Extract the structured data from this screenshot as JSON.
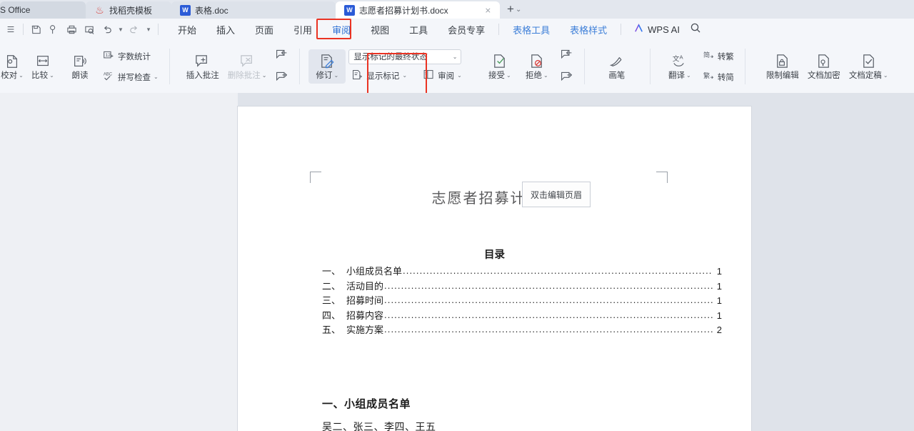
{
  "window": {
    "tabs": [
      {
        "label": "S Office",
        "icon": "wps-home-icon",
        "type": "home"
      },
      {
        "label": "找稻壳模板",
        "icon": "docer-icon",
        "type": "inactive"
      },
      {
        "label": "表格.doc",
        "icon": "word-icon",
        "type": "inactive"
      },
      {
        "label": "志愿者招募计划书.docx",
        "icon": "word-icon",
        "type": "active"
      }
    ],
    "new_tab_label": "+",
    "new_tab_caret": "⌄",
    "close_glyph": "⨯"
  },
  "quick_access": [
    {
      "name": "save-icon"
    },
    {
      "name": "cloud-sync-icon"
    },
    {
      "name": "print-icon"
    },
    {
      "name": "print-preview-icon"
    },
    {
      "name": "undo-icon"
    },
    {
      "name": "undo-caret"
    },
    {
      "name": "redo-icon"
    },
    {
      "name": "more-caret"
    }
  ],
  "ribbon_tabs": [
    {
      "label": "开始",
      "state": "normal"
    },
    {
      "label": "插入",
      "state": "normal"
    },
    {
      "label": "页面",
      "state": "normal"
    },
    {
      "label": "引用",
      "state": "normal"
    },
    {
      "label": "审阅",
      "state": "active"
    },
    {
      "label": "视图",
      "state": "normal"
    },
    {
      "label": "工具",
      "state": "normal"
    },
    {
      "label": "会员专享",
      "state": "normal"
    },
    {
      "label": "表格工具",
      "state": "contextual"
    },
    {
      "label": "表格样式",
      "state": "contextual"
    }
  ],
  "wps_ai": {
    "label": "WPS AI",
    "icon": "wps-ai-icon"
  },
  "search": {
    "icon": "search-icon"
  },
  "ribbon": {
    "group_proof": [
      {
        "label": "校对",
        "icon": "proofread-icon",
        "caret": "⌄",
        "disabled": false
      },
      {
        "label": "比较",
        "icon": "compare-icon",
        "caret": "⌄",
        "disabled": false
      },
      {
        "label": "朗读",
        "icon": "read-aloud-icon",
        "caret": "",
        "disabled": false
      }
    ],
    "group_proof_stack": [
      {
        "label": "字数统计",
        "icon": "word-count-icon",
        "caret": ""
      },
      {
        "label": "拼写检查",
        "icon": "spell-check-icon",
        "caret": "⌄"
      }
    ],
    "group_comment": [
      {
        "label": "插入批注",
        "icon": "insert-comment-icon",
        "caret": "",
        "disabled": false
      },
      {
        "label": "删除批注",
        "icon": "delete-comment-icon",
        "caret": "⌄",
        "disabled": true
      }
    ],
    "group_comment_nav": [
      {
        "label": "",
        "icon": "previous-comment-icon"
      },
      {
        "label": "",
        "icon": "next-comment-icon"
      }
    ],
    "group_track": {
      "track_changes": {
        "label": "修订",
        "icon": "track-changes-icon",
        "caret": "⌄",
        "selected": true
      },
      "display_mode": {
        "value": "显示标记的最终状态",
        "caret": "⌄"
      },
      "show_markup": {
        "label": "显示标记",
        "icon": "show-markup-icon",
        "caret": "⌄"
      },
      "review_pane": {
        "label": "审阅",
        "icon": "review-pane-icon",
        "caret": "⌄"
      }
    },
    "group_accept": [
      {
        "label": "接受",
        "icon": "accept-change-icon",
        "caret": "⌄"
      },
      {
        "label": "拒绝",
        "icon": "reject-change-icon",
        "caret": "⌄"
      }
    ],
    "group_accept_nav": [
      {
        "label": "",
        "icon": "previous-change-icon"
      },
      {
        "label": "",
        "icon": "next-change-icon"
      }
    ],
    "group_pen": [
      {
        "label": "画笔",
        "icon": "pen-icon",
        "caret": ""
      }
    ],
    "group_translate": [
      {
        "label": "翻译",
        "icon": "translate-icon",
        "caret": "⌄"
      }
    ],
    "group_convert": [
      {
        "label": "转繁",
        "icon": "simplified-to-traditional-icon"
      },
      {
        "label": "转简",
        "icon": "traditional-to-simplified-icon"
      }
    ],
    "group_protect": [
      {
        "label": "限制编辑",
        "icon": "restrict-edit-icon",
        "caret": ""
      },
      {
        "label": "文档加密",
        "icon": "encrypt-document-icon",
        "caret": ""
      },
      {
        "label": "文档定稿",
        "icon": "finalize-document-icon",
        "caret": "⌄"
      }
    ]
  },
  "annotations": {
    "highlight_color": "#ea3323",
    "boxes": [
      {
        "name": "review-tab-highlight"
      },
      {
        "name": "review-pane-button-highlight"
      }
    ]
  },
  "document": {
    "title": "志愿者招募计划书",
    "header_tooltip": "双击编辑页眉",
    "toc_title": "目录",
    "toc": [
      {
        "num": "一、",
        "text": "小组成员名单",
        "page": "1"
      },
      {
        "num": "二、",
        "text": "活动目的",
        "page": "1"
      },
      {
        "num": "三、",
        "text": "招募时间",
        "page": "1"
      },
      {
        "num": "四、",
        "text": "招募内容",
        "page": "1"
      },
      {
        "num": "五、",
        "text": "实施方案",
        "page": "2"
      }
    ],
    "section_heading": "一、小组成员名单",
    "section_body": "吴二、张三、李四、王五"
  }
}
